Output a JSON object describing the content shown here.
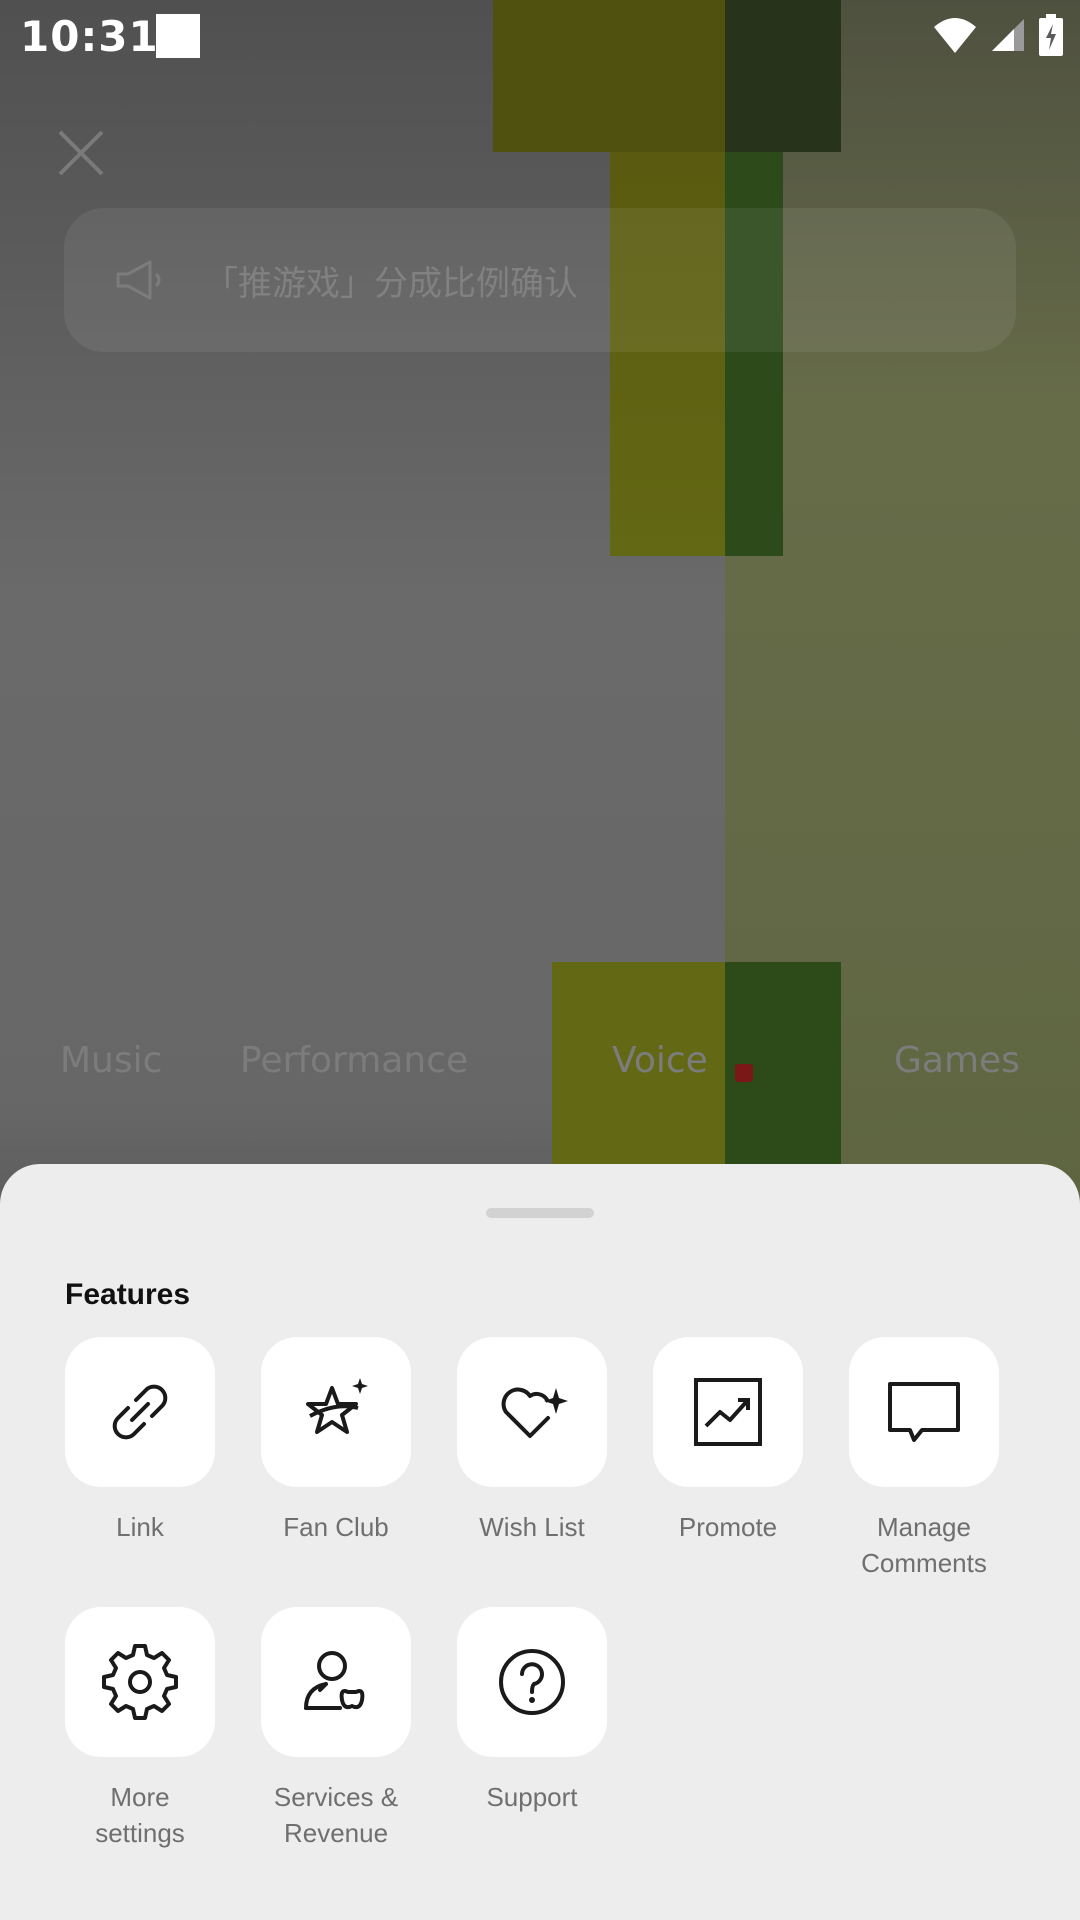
{
  "status_bar": {
    "time": "10:31"
  },
  "background": {
    "notice_text": "「推游戏」分成比例确认",
    "tabs": [
      "Music",
      "Performance",
      "Voice",
      "Games"
    ]
  },
  "sheet": {
    "title": "Features",
    "features": [
      {
        "label": "Link",
        "icon": "link-icon"
      },
      {
        "label": "Fan Club",
        "icon": "star-sparkle-icon"
      },
      {
        "label": "Wish List",
        "icon": "heart-sparkle-icon"
      },
      {
        "label": "Promote",
        "icon": "trend-chart-icon"
      },
      {
        "label": "Manage Comments",
        "icon": "comment-icon"
      },
      {
        "label": "More settings",
        "icon": "gear-icon"
      },
      {
        "label": "Services & Revenue",
        "icon": "user-butterfly-icon"
      },
      {
        "label": "Support",
        "icon": "question-icon"
      }
    ]
  }
}
